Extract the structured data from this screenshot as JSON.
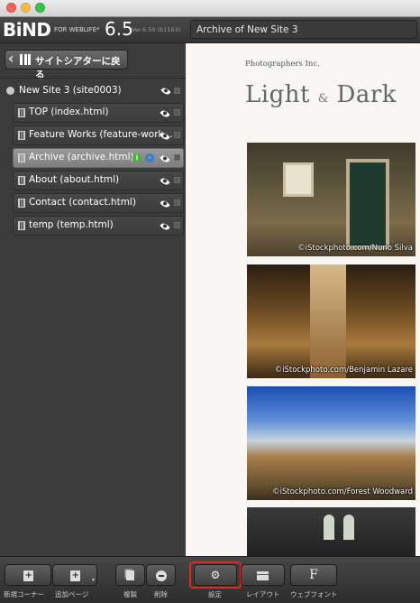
{
  "app": {
    "logo": "BiND",
    "logo_sub": "FOR WEBLIFE*",
    "version": "6.5",
    "build": "Ver.6.50 (b1163)"
  },
  "sidebar": {
    "back_label": "サイトシアターに戻る",
    "root": "New Site 3 (site0003)",
    "pages": [
      {
        "label": "TOP (index.html)"
      },
      {
        "label": "Feature Works (feature-work..."
      },
      {
        "label": "Archive (archive.html)"
      },
      {
        "label": "About (about.html)"
      },
      {
        "label": "Contact (contact.html)"
      },
      {
        "label": "temp (temp.html)"
      }
    ]
  },
  "header": {
    "site_title": "Archive of New Site 3"
  },
  "preview": {
    "brand_small": "Photographers Inc.",
    "brand_light": "Light",
    "brand_amp": "&",
    "brand_dark": "Dark",
    "photos": [
      {
        "credit": "©iStockphoto.com/Nuno Silva"
      },
      {
        "credit": "©iStockphoto.com/Benjamin Lazare"
      },
      {
        "credit": "©iStockphoto.com/Forest Woodward"
      }
    ]
  },
  "bottom_left": {
    "new_corner": "新規コーナー",
    "add_page": "追加ページ",
    "duplicate": "複製",
    "delete": "削除"
  },
  "bottom_right": {
    "settings": "設定",
    "layout": "レイアウト",
    "webfont": "ウェブフォント",
    "webfont_glyph": "F"
  }
}
